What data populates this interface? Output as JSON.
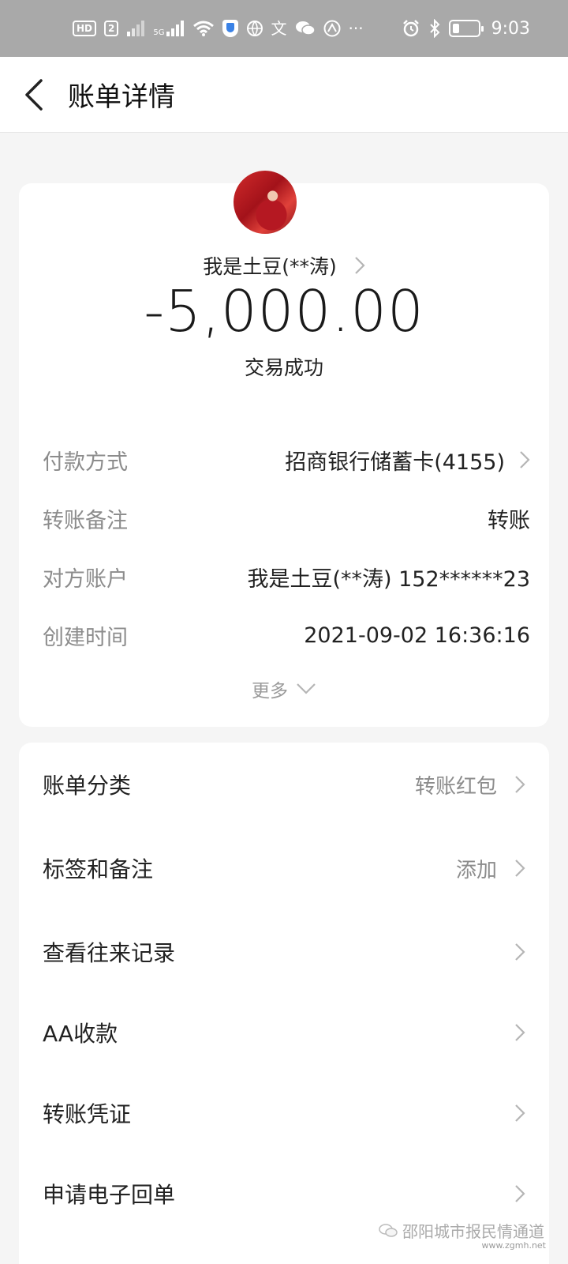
{
  "status_bar": {
    "hd_label": "HD",
    "sim_label": "2",
    "net_label": "5G",
    "translate_glyph": "文",
    "more_glyph": "···",
    "time": "9:03",
    "icons": [
      "hd-icon",
      "sim-icon",
      "signal-icon",
      "5g-signal-icon",
      "wifi-icon",
      "shield-icon",
      "globe-icon",
      "translate-icon",
      "wechat-icon",
      "alipay-icon",
      "more-icon",
      "alarm-icon",
      "bluetooth-icon",
      "battery-icon"
    ]
  },
  "header": {
    "title": "账单详情"
  },
  "summary": {
    "payee": "我是土豆(**涛)",
    "amount": "-5,000.00",
    "status": "交易成功"
  },
  "details": [
    {
      "label": "付款方式",
      "value": "招商银行储蓄卡(4155)"
    },
    {
      "label": "转账备注",
      "value": "转账"
    },
    {
      "label": "对方账户",
      "value": "我是土豆(**涛) 152******23"
    },
    {
      "label": "创建时间",
      "value": "2021-09-02 16:36:16"
    }
  ],
  "more_label": "更多",
  "menu": [
    {
      "label": "账单分类",
      "value": "转账红包"
    },
    {
      "label": "标签和备注",
      "value": "添加"
    },
    {
      "label": "查看往来记录",
      "value": ""
    },
    {
      "label": "AA收款",
      "value": ""
    },
    {
      "label": "转账凭证",
      "value": ""
    },
    {
      "label": "申请电子回单",
      "value": ""
    }
  ],
  "watermark": {
    "text": "邵阳城市报民情通道",
    "url": "www.zgmh.net"
  },
  "colors": {
    "status_bar_bg": "#a9a9a9",
    "page_bg": "#f5f5f5",
    "card_bg": "#ffffff",
    "label_gray": "#8c8c8c",
    "text_dark": "#222222"
  }
}
